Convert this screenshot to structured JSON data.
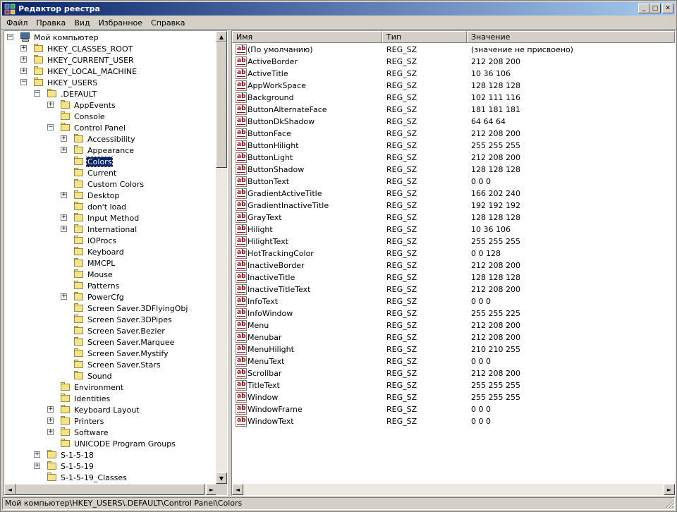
{
  "window": {
    "title": "Редактор реестра",
    "minimize": "_",
    "maximize": "□",
    "close": "✕"
  },
  "menu": [
    {
      "label": "Файл"
    },
    {
      "label": "Правка"
    },
    {
      "label": "Вид"
    },
    {
      "label": "Избранное"
    },
    {
      "label": "Справка"
    }
  ],
  "tree": {
    "expand_glyph": "+",
    "collapse_glyph": "−",
    "items": [
      {
        "label": "Мой компьютер",
        "level": 0,
        "exp": "minus",
        "icon": "computer-icon"
      },
      {
        "label": "HKEY_CLASSES_ROOT",
        "level": 1,
        "exp": "plus",
        "icon": "folder-icon"
      },
      {
        "label": "HKEY_CURRENT_USER",
        "level": 1,
        "exp": "plus",
        "icon": "folder-icon"
      },
      {
        "label": "HKEY_LOCAL_MACHINE",
        "level": 1,
        "exp": "plus",
        "icon": "folder-icon"
      },
      {
        "label": "HKEY_USERS",
        "level": 1,
        "exp": "minus",
        "icon": "folder-icon"
      },
      {
        "label": ".DEFAULT",
        "level": 2,
        "exp": "minus",
        "icon": "folder-icon"
      },
      {
        "label": "AppEvents",
        "level": 3,
        "exp": "plus",
        "icon": "folder-icon"
      },
      {
        "label": "Console",
        "level": 3,
        "exp": "none",
        "icon": "folder-icon"
      },
      {
        "label": "Control Panel",
        "level": 3,
        "exp": "minus",
        "icon": "folder-icon"
      },
      {
        "label": "Accessibility",
        "level": 4,
        "exp": "plus",
        "icon": "folder-icon"
      },
      {
        "label": "Appearance",
        "level": 4,
        "exp": "plus",
        "icon": "folder-icon"
      },
      {
        "label": "Colors",
        "level": 4,
        "exp": "none",
        "icon": "folder-open-icon",
        "selected": true
      },
      {
        "label": "Current",
        "level": 4,
        "exp": "none",
        "icon": "folder-icon"
      },
      {
        "label": "Custom Colors",
        "level": 4,
        "exp": "none",
        "icon": "folder-icon"
      },
      {
        "label": "Desktop",
        "level": 4,
        "exp": "plus",
        "icon": "folder-icon"
      },
      {
        "label": "don't load",
        "level": 4,
        "exp": "none",
        "icon": "folder-icon"
      },
      {
        "label": "Input Method",
        "level": 4,
        "exp": "plus",
        "icon": "folder-icon"
      },
      {
        "label": "International",
        "level": 4,
        "exp": "plus",
        "icon": "folder-icon"
      },
      {
        "label": "IOProcs",
        "level": 4,
        "exp": "none",
        "icon": "folder-icon"
      },
      {
        "label": "Keyboard",
        "level": 4,
        "exp": "none",
        "icon": "folder-icon"
      },
      {
        "label": "MMCPL",
        "level": 4,
        "exp": "none",
        "icon": "folder-icon"
      },
      {
        "label": "Mouse",
        "level": 4,
        "exp": "none",
        "icon": "folder-icon"
      },
      {
        "label": "Patterns",
        "level": 4,
        "exp": "none",
        "icon": "folder-icon"
      },
      {
        "label": "PowerCfg",
        "level": 4,
        "exp": "plus",
        "icon": "folder-icon"
      },
      {
        "label": "Screen Saver.3DFlyingObj",
        "level": 4,
        "exp": "none",
        "icon": "folder-icon"
      },
      {
        "label": "Screen Saver.3DPipes",
        "level": 4,
        "exp": "none",
        "icon": "folder-icon"
      },
      {
        "label": "Screen Saver.Bezier",
        "level": 4,
        "exp": "none",
        "icon": "folder-icon"
      },
      {
        "label": "Screen Saver.Marquee",
        "level": 4,
        "exp": "none",
        "icon": "folder-icon"
      },
      {
        "label": "Screen Saver.Mystify",
        "level": 4,
        "exp": "none",
        "icon": "folder-icon"
      },
      {
        "label": "Screen Saver.Stars",
        "level": 4,
        "exp": "none",
        "icon": "folder-icon"
      },
      {
        "label": "Sound",
        "level": 4,
        "exp": "none",
        "icon": "folder-icon"
      },
      {
        "label": "Environment",
        "level": 3,
        "exp": "none",
        "icon": "folder-icon"
      },
      {
        "label": "Identities",
        "level": 3,
        "exp": "none",
        "icon": "folder-icon"
      },
      {
        "label": "Keyboard Layout",
        "level": 3,
        "exp": "plus",
        "icon": "folder-icon"
      },
      {
        "label": "Printers",
        "level": 3,
        "exp": "plus",
        "icon": "folder-icon"
      },
      {
        "label": "Software",
        "level": 3,
        "exp": "plus",
        "icon": "folder-icon"
      },
      {
        "label": "UNICODE Program Groups",
        "level": 3,
        "exp": "none",
        "icon": "folder-icon"
      },
      {
        "label": "S-1-5-18",
        "level": 2,
        "exp": "plus",
        "icon": "folder-icon"
      },
      {
        "label": "S-1-5-19",
        "level": 2,
        "exp": "plus",
        "icon": "folder-icon"
      },
      {
        "label": "S-1-5-19_Classes",
        "level": 2,
        "exp": "none",
        "icon": "folder-icon"
      }
    ]
  },
  "list": {
    "columns": [
      {
        "label": "Имя"
      },
      {
        "label": "Тип"
      },
      {
        "label": "Значение"
      }
    ],
    "icon_text": "ab",
    "rows": [
      {
        "name": "(По умолчанию)",
        "type": "REG_SZ",
        "data": "(значение не присвоено)"
      },
      {
        "name": "ActiveBorder",
        "type": "REG_SZ",
        "data": "212 208 200"
      },
      {
        "name": "ActiveTitle",
        "type": "REG_SZ",
        "data": "10 36 106"
      },
      {
        "name": "AppWorkSpace",
        "type": "REG_SZ",
        "data": "128 128 128"
      },
      {
        "name": "Background",
        "type": "REG_SZ",
        "data": "102 111 116"
      },
      {
        "name": "ButtonAlternateFace",
        "type": "REG_SZ",
        "data": "181 181 181"
      },
      {
        "name": "ButtonDkShadow",
        "type": "REG_SZ",
        "data": "64 64 64"
      },
      {
        "name": "ButtonFace",
        "type": "REG_SZ",
        "data": "212 208 200"
      },
      {
        "name": "ButtonHilight",
        "type": "REG_SZ",
        "data": "255 255 255"
      },
      {
        "name": "ButtonLight",
        "type": "REG_SZ",
        "data": "212 208 200"
      },
      {
        "name": "ButtonShadow",
        "type": "REG_SZ",
        "data": "128 128 128"
      },
      {
        "name": "ButtonText",
        "type": "REG_SZ",
        "data": "0 0 0"
      },
      {
        "name": "GradientActiveTitle",
        "type": "REG_SZ",
        "data": "166 202 240"
      },
      {
        "name": "GradientInactiveTitle",
        "type": "REG_SZ",
        "data": "192 192 192"
      },
      {
        "name": "GrayText",
        "type": "REG_SZ",
        "data": "128 128 128"
      },
      {
        "name": "Hilight",
        "type": "REG_SZ",
        "data": "10 36 106"
      },
      {
        "name": "HilightText",
        "type": "REG_SZ",
        "data": "255 255 255"
      },
      {
        "name": "HotTrackingColor",
        "type": "REG_SZ",
        "data": "0 0 128"
      },
      {
        "name": "InactiveBorder",
        "type": "REG_SZ",
        "data": "212 208 200"
      },
      {
        "name": "InactiveTitle",
        "type": "REG_SZ",
        "data": "128 128 128"
      },
      {
        "name": "InactiveTitleText",
        "type": "REG_SZ",
        "data": "212 208 200"
      },
      {
        "name": "InfoText",
        "type": "REG_SZ",
        "data": "0 0 0"
      },
      {
        "name": "InfoWindow",
        "type": "REG_SZ",
        "data": "255 255 225"
      },
      {
        "name": "Menu",
        "type": "REG_SZ",
        "data": "212 208 200"
      },
      {
        "name": "Menubar",
        "type": "REG_SZ",
        "data": "212 208 200"
      },
      {
        "name": "MenuHilight",
        "type": "REG_SZ",
        "data": "210 210 255"
      },
      {
        "name": "MenuText",
        "type": "REG_SZ",
        "data": "0 0 0"
      },
      {
        "name": "Scrollbar",
        "type": "REG_SZ",
        "data": "212 208 200"
      },
      {
        "name": "TitleText",
        "type": "REG_SZ",
        "data": "255 255 255"
      },
      {
        "name": "Window",
        "type": "REG_SZ",
        "data": "255 255 255"
      },
      {
        "name": "WindowFrame",
        "type": "REG_SZ",
        "data": "0 0 0"
      },
      {
        "name": "WindowText",
        "type": "REG_SZ",
        "data": "0 0 0"
      }
    ]
  },
  "scroll": {
    "up": "▲",
    "down": "▼",
    "left": "◄",
    "right": "►"
  },
  "status": {
    "path": "Мой компьютер\\HKEY_USERS\\.DEFAULT\\Control Panel\\Colors"
  },
  "colors": {
    "title_start": "#0a246a",
    "title_end": "#a6caf0",
    "selection": "#0a246a",
    "face": "#d4d0c8"
  }
}
